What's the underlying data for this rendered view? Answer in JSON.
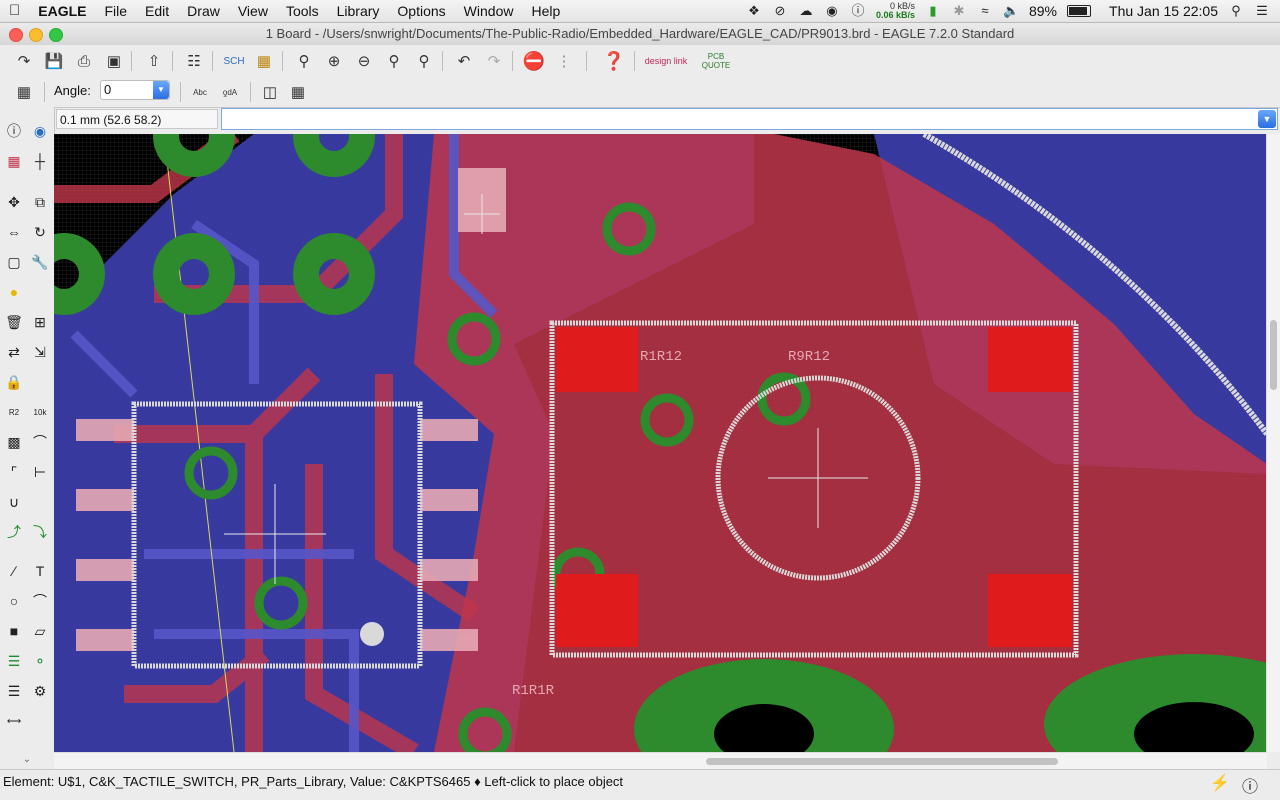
{
  "menubar": {
    "apple": "",
    "app": "EAGLE",
    "items": [
      "File",
      "Edit",
      "Draw",
      "View",
      "Tools",
      "Library",
      "Options",
      "Window",
      "Help"
    ],
    "net_up": "0 kB/s",
    "net_down": "0.06 kB/s",
    "battery_percent": "89%",
    "battery_level": 0.89,
    "clock": "Thu Jan 15  22:05"
  },
  "window": {
    "title": "1 Board - /Users/snwright/Documents/The-Public-Radio/Embedded_Hardware/EAGLE_CAD/PR9013.brd - EAGLE 7.2.0 Standard"
  },
  "toolbar": {
    "icons": [
      "open-icon",
      "save-icon",
      "print-icon",
      "cam-icon",
      "ulp-icon",
      "layer-settings-icon",
      "schematic-icon",
      "board-icon",
      "zoom-fit-icon",
      "zoom-in-icon",
      "zoom-out-icon",
      "zoom-area-icon",
      "zoom-select-icon",
      "undo-icon",
      "redo-icon",
      "stop-icon",
      "go-icon",
      "help-icon"
    ],
    "designlink_label": "design link",
    "pcbquote_label": "PCB QUOTE"
  },
  "param_bar": {
    "angle_label": "Angle:",
    "angle_value": "0",
    "icons": [
      "grid-icon",
      "abc-text-icon",
      "abc-mirror-icon",
      "mirror-icon",
      "rotate-icon"
    ]
  },
  "coord": {
    "readout": "0.1 mm (52.6 58.2)"
  },
  "command": {
    "value": "",
    "placeholder": ""
  },
  "palette": {
    "tools": [
      "info-tool",
      "show-tool",
      "display-tool",
      "mark-tool",
      "move-tool",
      "copy-tool",
      "mirror-tool",
      "rotate-tool",
      "group-tool",
      "change-tool",
      "paste-tool",
      "delete-tool",
      "add-tool",
      "replace-tool",
      "lock-tool",
      "name-tool",
      "value-tool",
      "smash-tool",
      "miter-tool",
      "split-tool",
      "optimize-tool",
      "meander-tool",
      "route-tool",
      "ripup-tool",
      "wire-tool",
      "text-tool",
      "circle-tool",
      "arc-tool",
      "rect-tool",
      "polygon-tool",
      "via-tool",
      "signal-tool",
      "hole-tool",
      "attribute-tool",
      "dimension-tool"
    ]
  },
  "status": {
    "text": "Element: U$1, C&K_TACTILE_SWITCH, PR_Parts_Library, Value: C&KPTS6465  ♦ Left-click to place object"
  },
  "canvas": {
    "silk_labels": [
      "R1R12",
      "R9R12",
      "R1R1R"
    ],
    "colors": {
      "background": "#000000",
      "top_copper": "#c0364a",
      "bottom_copper": "#3b3ca8",
      "pads": "#2d8a2d",
      "smd": "#e01b1b",
      "silk": "#d9d9d9",
      "grid": "#3a3a3a"
    }
  }
}
